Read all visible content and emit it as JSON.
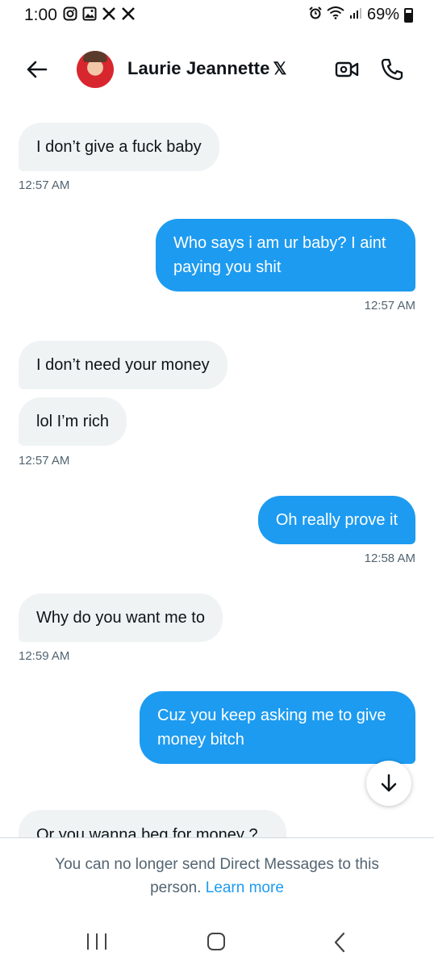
{
  "status_bar": {
    "time": "1:00",
    "battery": "69%",
    "left_icons": [
      "instagram-icon",
      "gallery-icon",
      "x-app-icon",
      "x-app-icon"
    ],
    "right_icons": [
      "alarm-icon",
      "wifi-icon",
      "signal-icon",
      "battery-icon"
    ]
  },
  "header": {
    "name": "Laurie Jeannette",
    "badge": "𝕏"
  },
  "messages": [
    {
      "direction": "in",
      "text": "I don’t give a fuck baby"
    },
    {
      "direction": "out",
      "text": "Who says i am ur baby? I aint paying you shit"
    },
    {
      "direction": "in",
      "text": "I don’t need your money"
    },
    {
      "direction": "in",
      "text": "lol I’m rich"
    },
    {
      "direction": "out",
      "text": "Oh really prove it"
    },
    {
      "direction": "in",
      "text": "Why do you want me to"
    },
    {
      "direction": "out",
      "text": "Cuz you keep asking me to give money bitch"
    },
    {
      "direction": "in",
      "text": "Or you wanna beg for money ?"
    }
  ],
  "timestamps": [
    "12:57 AM",
    "12:57 AM",
    "12:57 AM",
    "12:58 AM",
    "12:59 AM"
  ],
  "footer": {
    "notice": "You can no longer send Direct Messages to this person.",
    "learn_more": "Learn more"
  }
}
